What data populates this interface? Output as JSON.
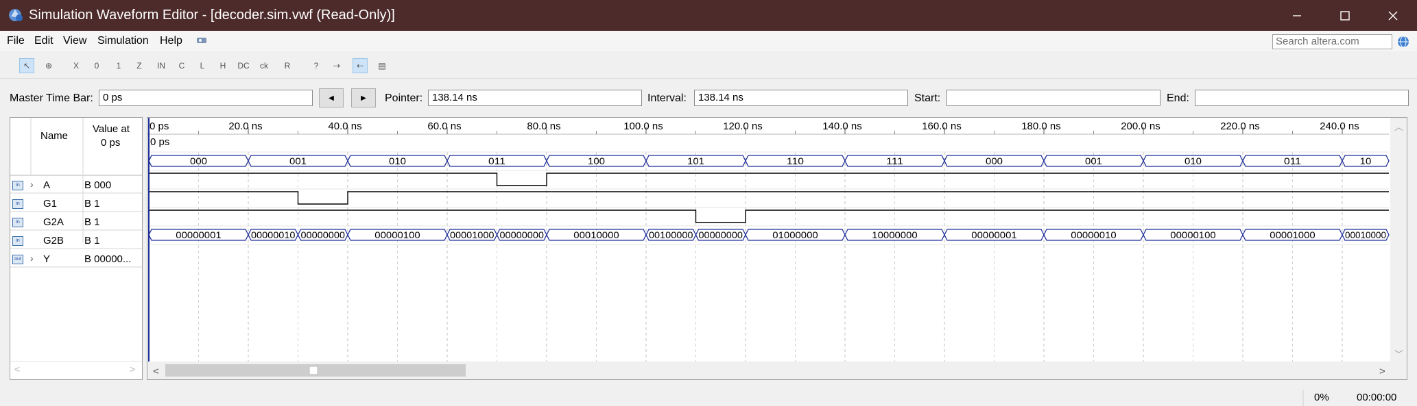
{
  "window": {
    "title": "Simulation Waveform Editor - [decoder.sim.vwf (Read-Only)]"
  },
  "menu": [
    "File",
    "Edit",
    "View",
    "Simulation",
    "Help"
  ],
  "search": {
    "placeholder": "Search altera.com"
  },
  "toolbar_icons": [
    "selection-tool-icon",
    "zoom-tool-icon",
    "forcing-unknown-icon",
    "forcing-low-icon",
    "forcing-high-icon",
    "high-impedance-icon",
    "invert-icon",
    "count-value-icon",
    "weak-low-icon",
    "weak-high-icon",
    "dont-care-icon",
    "clock-icon",
    "random-value-icon",
    "arbitrary-value-icon",
    "snap-to-grid-icon",
    "grid-icon",
    "waveform-cursor-icon"
  ],
  "timebar": {
    "master_label": "Master Time Bar:",
    "master_value": "0 ps",
    "pointer_label": "Pointer:",
    "pointer_value": "138.14 ns",
    "interval_label": "Interval:",
    "interval_value": "138.14 ns",
    "start_label": "Start:",
    "start_value": "",
    "end_label": "End:",
    "end_value": ""
  },
  "columns": {
    "name": "Name",
    "value_line1": "Value at",
    "value_line2": "0 ps"
  },
  "time_axis": [
    "0 ps",
    "20.0 ns",
    "40.0 ns",
    "60.0 ns",
    "80.0 ns",
    "100.0 ns",
    "120.0 ns",
    "140.0 ns",
    "160.0 ns",
    "180.0 ns",
    "200.0 ns",
    "220.0 ns",
    "240.0 ns"
  ],
  "cursor_label": "0 ps",
  "signals": [
    {
      "name": "A",
      "value": "B 000",
      "icon": "input-bus-icon",
      "expandable": true,
      "type": "bus",
      "segments": [
        [
          "000",
          0,
          10
        ],
        [
          "001",
          10,
          20
        ],
        [
          "010",
          20,
          30
        ],
        [
          "011",
          30,
          40
        ],
        [
          "100",
          40,
          50
        ],
        [
          "101",
          50,
          60
        ],
        [
          "110",
          60,
          70
        ],
        [
          "111",
          70,
          80
        ],
        [
          "000",
          80,
          90
        ],
        [
          "001",
          90,
          100
        ],
        [
          "010",
          100,
          110
        ],
        [
          "011",
          110,
          120
        ],
        [
          "10",
          120,
          125
        ]
      ]
    },
    {
      "name": "G1",
      "value": "B 1",
      "icon": "input-pin-icon",
      "expandable": false,
      "type": "bit",
      "levels": [
        [
          1,
          0,
          35
        ],
        [
          0,
          35,
          40
        ],
        [
          1,
          40,
          125
        ]
      ]
    },
    {
      "name": "G2A",
      "value": "B 1",
      "icon": "input-pin-icon",
      "expandable": false,
      "type": "bit",
      "levels": [
        [
          1,
          0,
          15
        ],
        [
          0,
          15,
          20
        ],
        [
          1,
          20,
          125
        ]
      ]
    },
    {
      "name": "G2B",
      "value": "B 1",
      "icon": "input-pin-icon",
      "expandable": false,
      "type": "bit",
      "levels": [
        [
          1,
          0,
          55
        ],
        [
          0,
          55,
          60
        ],
        [
          1,
          60,
          125
        ]
      ]
    },
    {
      "name": "Y",
      "value": "B 00000...",
      "icon": "output-bus-icon",
      "expandable": true,
      "type": "bus",
      "segments": [
        [
          "00000001",
          0,
          10
        ],
        [
          "00000010",
          10,
          15
        ],
        [
          "00000000",
          15,
          20
        ],
        [
          "00000100",
          20,
          30
        ],
        [
          "00001000",
          30,
          35
        ],
        [
          "00000000",
          35,
          40
        ],
        [
          "00010000",
          40,
          50
        ],
        [
          "00100000",
          50,
          55
        ],
        [
          "00000000",
          55,
          60
        ],
        [
          "01000000",
          60,
          70
        ],
        [
          "10000000",
          70,
          80
        ],
        [
          "00000001",
          80,
          90
        ],
        [
          "00000010",
          90,
          100
        ],
        [
          "00000100",
          100,
          110
        ],
        [
          "00001000",
          110,
          120
        ],
        [
          "00010000",
          120,
          125
        ]
      ]
    }
  ],
  "status": {
    "progress": "0%",
    "elapsed": "00:00:00"
  }
}
